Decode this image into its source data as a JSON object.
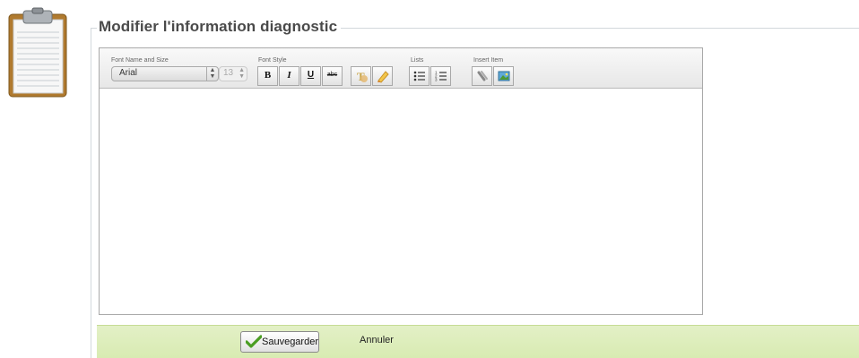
{
  "page": {
    "title": "Modifier l'information diagnostic"
  },
  "toolbar": {
    "font_group_label": "Font Name and Size",
    "font_name": "Arial",
    "font_size": "13",
    "style_group_label": "Font Style",
    "bold": "B",
    "italic": "I",
    "underline": "U",
    "strike": "abc",
    "lists_group_label": "Lists",
    "insert_group_label": "Insert Item"
  },
  "editor": {
    "content": ""
  },
  "footer": {
    "save_label": "Sauvegarder",
    "cancel_label": "Annuler"
  },
  "colors": {
    "footer_bg": "#d8ebb2",
    "check": "#4a9d22"
  }
}
